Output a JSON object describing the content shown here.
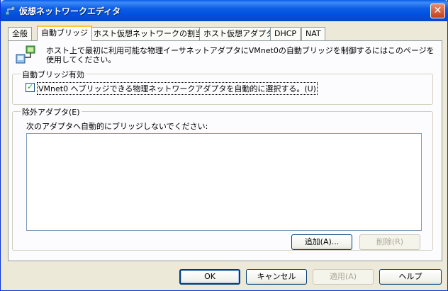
{
  "window": {
    "title": "仮想ネットワークエディタ"
  },
  "tabs": [
    {
      "label": "全般"
    },
    {
      "label": "自動ブリッジ"
    },
    {
      "label": "ホスト仮想ネットワークの割当て"
    },
    {
      "label": "ホスト仮想アダプタ"
    },
    {
      "label": "DHCP"
    },
    {
      "label": "NAT"
    }
  ],
  "intro": {
    "text": "ホスト上で最初に利用可能な物理イーサネットアダプタにVMnet0の自動ブリッジを制御するにはこのページを使用してください。"
  },
  "auto_bridge_group": {
    "legend": "自動ブリッジ有効",
    "checkbox_label": "VMnet0 へブリッジできる物理ネットワークアダプタを自動的に選択する。(U)",
    "checked": true
  },
  "excluded_group": {
    "legend": "除外アダプタ(E)",
    "description": "次のアダプタへ自動的にブリッジしないでください:",
    "add_button": "追加(A)...",
    "remove_button": "削除(R)"
  },
  "footer": {
    "ok": "OK",
    "cancel": "キャンセル",
    "apply": "適用(A)",
    "help": "ヘルプ"
  },
  "colors": {
    "titlebar": "#0a5fe8",
    "dialog_bg": "#ece9d8",
    "tab_active_accent": "#ffc83c"
  }
}
